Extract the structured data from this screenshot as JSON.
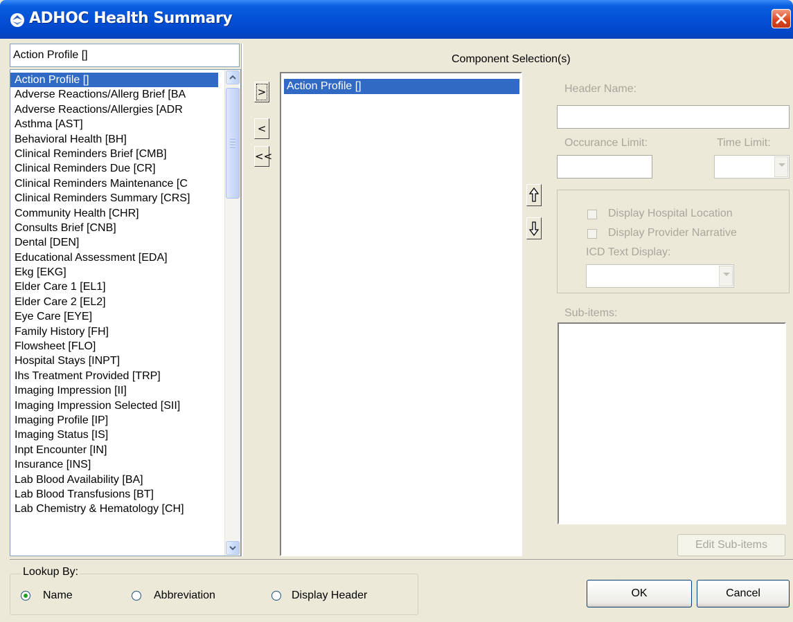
{
  "window": {
    "title": "ADHOC Health Summary"
  },
  "lookup": {
    "value": "Action Profile []"
  },
  "components": {
    "items": [
      "Action Profile []",
      "Adverse Reactions/Allerg Brief [BA",
      "Adverse Reactions/Allergies [ADR",
      "Asthma [AST]",
      "Behavioral Health [BH]",
      "Clinical Reminders Brief [CMB]",
      "Clinical Reminders Due [CR]",
      "Clinical Reminders Maintenance [C",
      "Clinical Reminders Summary [CRS]",
      "Community Health [CHR]",
      "Consults Brief [CNB]",
      "Dental [DEN]",
      "Educational Assessment [EDA]",
      "Ekg [EKG]",
      "Elder Care 1 [EL1]",
      "Elder Care 2 [EL2]",
      "Eye Care [EYE]",
      "Family History [FH]",
      "Flowsheet [FLO]",
      "Hospital Stays [INPT]",
      "Ihs Treatment Provided [TRP]",
      "Imaging Impression [II]",
      "Imaging Impression Selected [SII]",
      "Imaging Profile [IP]",
      "Imaging Status [IS]",
      "Inpt Encounter [IN]",
      "Insurance [INS]",
      "Lab Blood Availability [BA]",
      "Lab Blood Transfusions [BT]",
      "Lab Chemistry & Hematology [CH]"
    ],
    "selected_index": 0
  },
  "move_buttons": {
    "add": ">",
    "remove": "<",
    "remove_all": "<<"
  },
  "selection": {
    "title": "Component Selection(s)",
    "items": [
      "Action Profile []"
    ]
  },
  "details": {
    "header_name_label": "Header Name:",
    "occurance_limit_label": "Occurance Limit:",
    "time_limit_label": "Time Limit:",
    "display_hospital_location": "Display Hospital Location",
    "display_provider_narrative": "Display Provider Narrative",
    "icd_text_display_label": "ICD Text Display:",
    "sub_items_label": "Sub-items:",
    "edit_sub_items": "Edit Sub-items"
  },
  "lookup_by": {
    "legend": "Lookup By:",
    "options": [
      "Name",
      "Abbreviation",
      "Display Header"
    ],
    "selected": "Name"
  },
  "actions": {
    "ok": "OK",
    "cancel": "Cancel"
  },
  "colors": {
    "selection": "#316ac5",
    "face": "#ece9d8",
    "disabled_text": "#a9a79c"
  }
}
